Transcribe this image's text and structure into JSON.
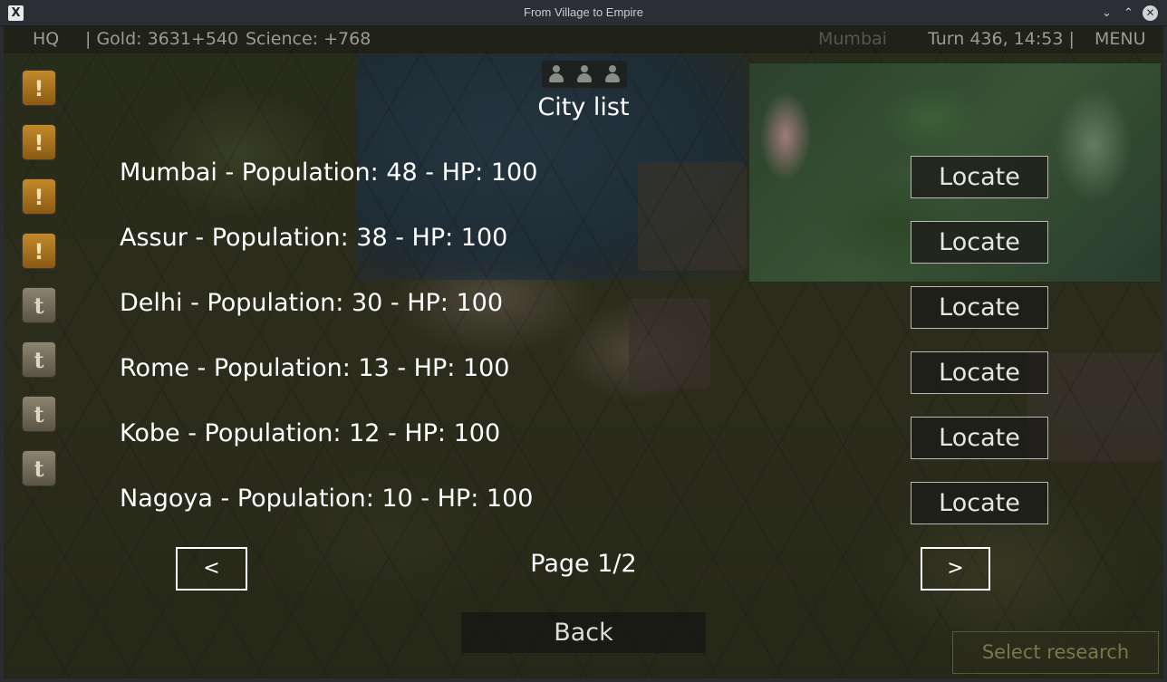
{
  "window": {
    "title": "From Village to Empire",
    "app_icon": "X"
  },
  "topbar": {
    "hq": "HQ",
    "gold": "| Gold: 3631+540",
    "science": "Science: +768",
    "city": "Mumbai",
    "turn": "Turn 436, 14:53 |",
    "menu": "MENU"
  },
  "notifications": [
    {
      "type": "alert",
      "icon": "exclamation-icon",
      "glyph": "!"
    },
    {
      "type": "alert",
      "icon": "exclamation-icon",
      "glyph": "!"
    },
    {
      "type": "alert",
      "icon": "exclamation-icon",
      "glyph": "!"
    },
    {
      "type": "alert",
      "icon": "exclamation-icon",
      "glyph": "!"
    },
    {
      "type": "tech",
      "icon": "t-icon",
      "glyph": "t"
    },
    {
      "type": "tech",
      "icon": "t-icon",
      "glyph": "t"
    },
    {
      "type": "tech",
      "icon": "t-icon",
      "glyph": "t"
    },
    {
      "type": "tech",
      "icon": "t-icon",
      "glyph": "t"
    }
  ],
  "panel": {
    "title": "City list",
    "cities": [
      {
        "text": "Mumbai - Population: 48 - HP: 100",
        "button": "Locate"
      },
      {
        "text": "Assur - Population: 38 - HP: 100",
        "button": "Locate"
      },
      {
        "text": "Delhi - Population: 30 - HP: 100",
        "button": "Locate"
      },
      {
        "text": "Rome - Population: 13 - HP: 100",
        "button": "Locate"
      },
      {
        "text": "Kobe - Population: 12 - HP: 100",
        "button": "Locate"
      },
      {
        "text": "Nagoya - Population: 10 - HP: 100",
        "button": "Locate"
      }
    ],
    "prev": "<",
    "next": ">",
    "page": "Page 1/2",
    "back": "Back"
  },
  "research_button": "Select research"
}
